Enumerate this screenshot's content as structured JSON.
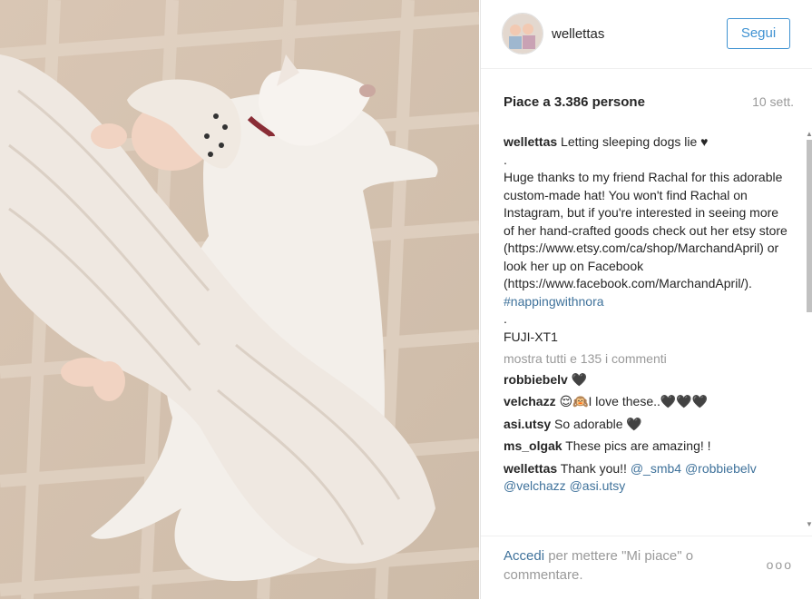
{
  "post": {
    "username": "wellettas",
    "follow_label": "Segui",
    "likes": "Piace a 3.386 persone",
    "date": "10 sett.",
    "caption": {
      "user": "wellettas",
      "title": "Letting sleeping dogs lie",
      "heart": "♥",
      "dot1": ".",
      "body": "Huge thanks to my friend Rachal for this adorable custom-made hat! You won't find Rachal on Instagram, but if you're interested in seeing more of her hand-crafted goods check out her etsy store (https://www.etsy.com/ca/shop/MarchandApril) or look her up on Facebook (https://www.facebook.com/MarchandApril/).",
      "hashtag": "#nappingwithnora",
      "dot2": ".",
      "camera": "FUJI-XT1"
    },
    "show_all_comments": "mostra tutti e 135 i commenti",
    "comments": [
      {
        "user": "robbiebelv",
        "text": "🖤"
      },
      {
        "user": "velchazz",
        "text": "😌🙉I love these..🖤🖤🖤"
      },
      {
        "user": "asi.utsy",
        "text": "So adorable 🖤"
      },
      {
        "user": "ms_olgak",
        "text": "These pics are amazing! !"
      }
    ],
    "last_comment": {
      "user": "wellettas",
      "text": "Thank you!!",
      "mentions": "@_smb4 @robbiebelv @velchazz @asi.utsy"
    },
    "footer": {
      "login_link": "Accedi",
      "login_rest": "per mettere \"Mi piace\" o commentare.",
      "options": "ooo"
    },
    "colors": {
      "accent": "#3f92d2",
      "link": "#3f729b",
      "muted": "#999999"
    }
  }
}
